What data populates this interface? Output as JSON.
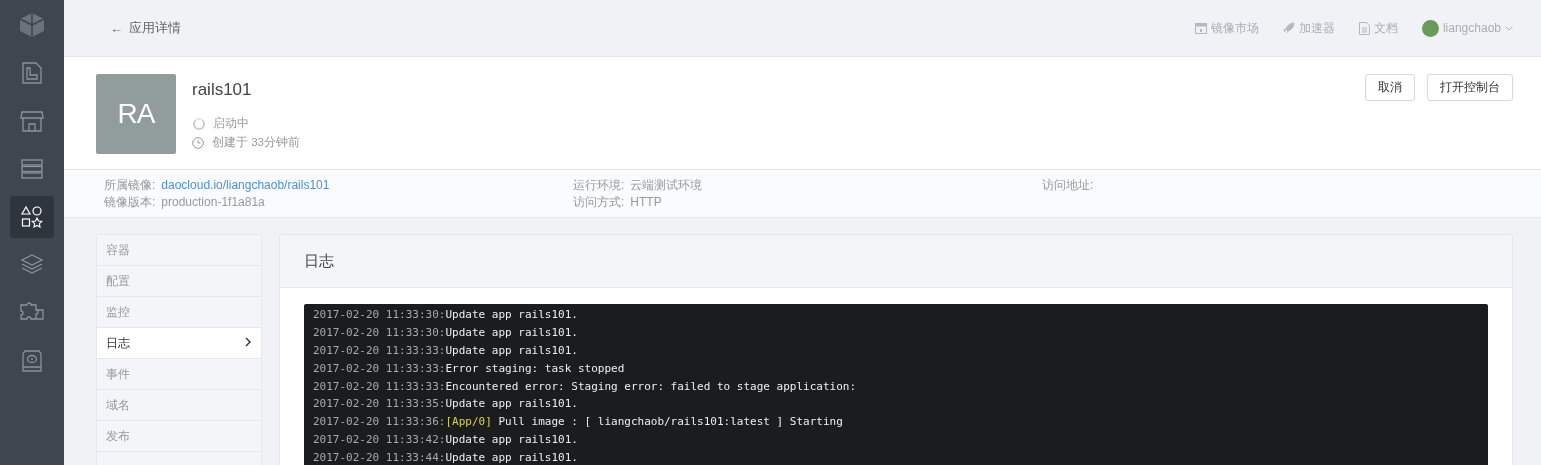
{
  "nav": [
    {
      "kind": "logo",
      "selected": false
    },
    {
      "kind": "doc",
      "selected": false
    },
    {
      "kind": "store",
      "selected": false
    },
    {
      "kind": "servers",
      "selected": false
    },
    {
      "kind": "shapes",
      "selected": true
    },
    {
      "kind": "layers",
      "selected": false
    },
    {
      "kind": "puzzle",
      "selected": false
    },
    {
      "kind": "disk",
      "selected": false
    }
  ],
  "header": {
    "back": "←",
    "title": "应用详情",
    "links": [
      {
        "kind": "store",
        "label": "镜像市场"
      },
      {
        "kind": "rocket",
        "label": "加速器"
      },
      {
        "kind": "doc",
        "label": "文档"
      }
    ],
    "user": "liangchaob"
  },
  "app": {
    "initials": "RA",
    "name": "rails101",
    "status": "启动中",
    "created": "创建于 33分钟前",
    "buttons": [
      "取消",
      "打开控制台"
    ]
  },
  "info": [
    {
      "label": "所属镜像:",
      "value": "daocloud.io/liangchaob/rails101",
      "link": true
    },
    {
      "label": "镜像版本:",
      "value": "production-1f1a81a",
      "link": false
    },
    {
      "label": "运行环境:",
      "value": "云端测试环境",
      "link": false
    },
    {
      "label": "访问方式:",
      "value": "HTTP",
      "link": false
    },
    {
      "label": "访问地址:"
    }
  ],
  "menu": [
    {
      "label": "容器",
      "selected": false
    },
    {
      "label": "配置",
      "selected": false
    },
    {
      "label": "监控",
      "selected": false
    },
    {
      "label": "日志",
      "selected": true
    },
    {
      "label": "事件",
      "selected": false
    },
    {
      "label": "域名",
      "selected": false
    },
    {
      "label": "发布",
      "selected": false
    }
  ],
  "log": {
    "title": "日志",
    "lines": [
      {
        "time": "2017-02-20 11:33:30:",
        "message": "Update app rails101."
      },
      {
        "time": "2017-02-20 11:33:30:",
        "message": "Update app rails101."
      },
      {
        "time": "2017-02-20 11:33:33:",
        "message": "Update app rails101."
      },
      {
        "time": "2017-02-20 11:33:33:",
        "message": "Error staging: task stopped"
      },
      {
        "time": "2017-02-20 11:33:33:",
        "message": "Encountered error: Staging error: failed to stage application:"
      },
      {
        "time": "2017-02-20 11:33:35:",
        "message": "Update app rails101."
      },
      {
        "time": "2017-02-20 11:33:36:",
        "tag": "[App/0]",
        "message": "Pull image : [ liangchaob/rails101:latest ] Starting"
      },
      {
        "time": "2017-02-20 11:33:42:",
        "message": "Update app rails101."
      },
      {
        "time": "2017-02-20 11:33:44:",
        "message": "Update app rails101."
      }
    ]
  }
}
